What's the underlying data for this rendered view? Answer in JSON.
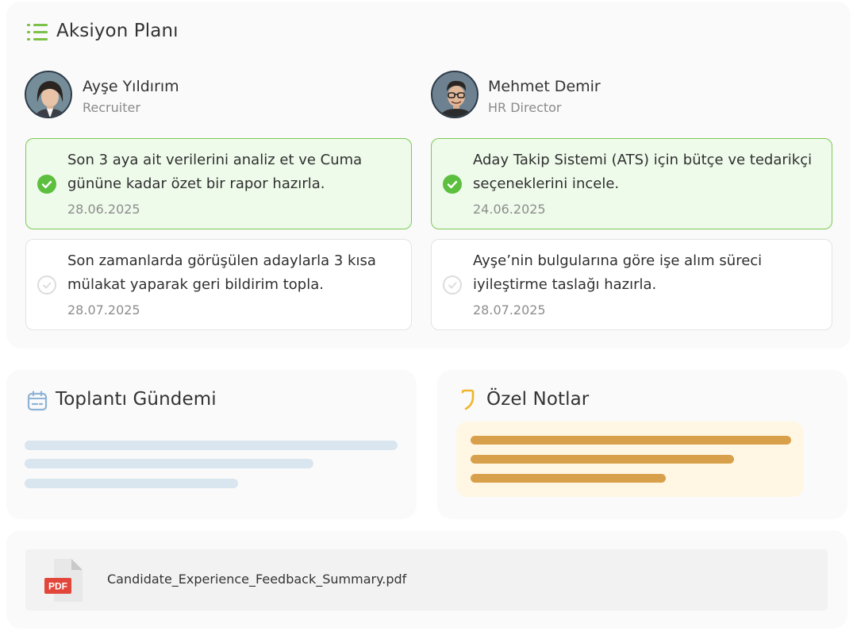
{
  "action_plan": {
    "title": "Aksiyon Planı",
    "people": [
      {
        "name": "Ayşe Yıldırım",
        "role": "Recruiter",
        "tasks": [
          {
            "text": "Son 3 aya ait verilerini analiz et ve Cuma gününe kadar özet bir rapor hazırla.",
            "date": "28.06.2025",
            "done": true
          },
          {
            "text": "Son zamanlarda görüşülen adaylarla 3 kısa mülakat yaparak geri bildirim topla.",
            "date": "28.07.2025",
            "done": false
          }
        ]
      },
      {
        "name": "Mehmet Demir",
        "role": "HR Director",
        "tasks": [
          {
            "text": "Aday Takip Sistemi (ATS) için bütçe ve tedarikçi seçeneklerini incele.",
            "date": "24.06.2025",
            "done": true
          },
          {
            "text": "Ayşe’nin bulgularına göre işe alım süreci iyileştirme taslağı hazırla.",
            "date": "28.07.2025",
            "done": false
          }
        ]
      }
    ]
  },
  "agenda": {
    "title": "Toplantı Gündemi",
    "icon": "calendar-icon"
  },
  "notes": {
    "title": "Özel Notlar",
    "icon": "quote-icon"
  },
  "attachment": {
    "file_name": "Candidate_Experience_Feedback_Summary.pdf",
    "badge": "PDF",
    "icon": "pdf-file-icon"
  },
  "colors": {
    "accent_green": "#5cbf3e",
    "done_bg": "#eefaea",
    "placeholder_blue": "#d9e5ef",
    "note_bar": "#d8a04a",
    "note_bg": "#fff7e4",
    "pdf_red": "#e2463a"
  }
}
